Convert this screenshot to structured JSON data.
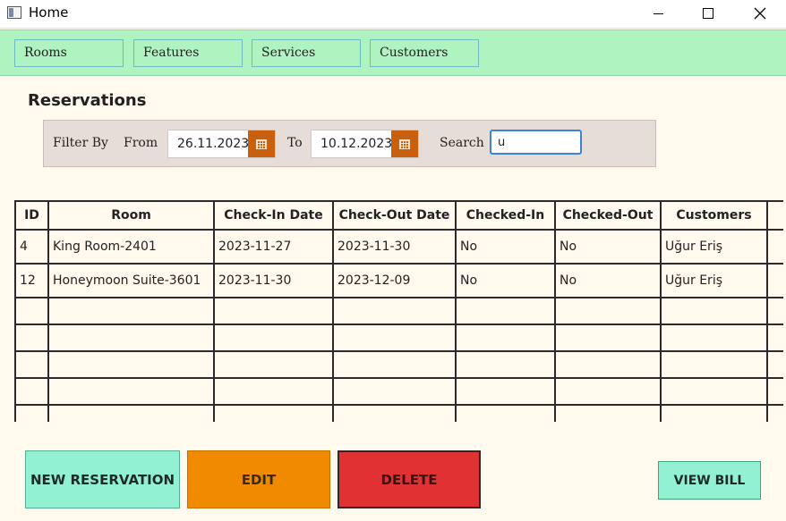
{
  "window": {
    "title": "Home",
    "minimize_label": "—",
    "maximize_label": "□",
    "close_label": "✕"
  },
  "nav": {
    "items": [
      {
        "label": "Rooms"
      },
      {
        "label": "Features"
      },
      {
        "label": "Services"
      },
      {
        "label": "Customers"
      }
    ]
  },
  "page": {
    "title": "Reservations"
  },
  "filter": {
    "filter_by_label": "Filter By",
    "from_label": "From",
    "from_value": "26.11.2023",
    "to_label": "To",
    "to_value": "10.12.2023",
    "search_label": "Search",
    "search_value": "u"
  },
  "table": {
    "columns": [
      "ID",
      "Room",
      "Check-In Date",
      "Check-Out Date",
      "Checked-In",
      "Checked-Out",
      "Customers"
    ],
    "rows": [
      [
        "4",
        "King Room-2401",
        "2023-11-27",
        "2023-11-30",
        "No",
        "No",
        "Uğur Eriş"
      ],
      [
        "12",
        "Honeymoon Suite-3601",
        "2023-11-30",
        "2023-12-09",
        "No",
        "No",
        "Uğur Eriş"
      ]
    ]
  },
  "buttons": {
    "new_reservation": "NEW RESERVATION",
    "edit": "EDIT",
    "delete": "DELETE",
    "view_bill": "VIEW BILL"
  },
  "colors": {
    "nav_bg": "#aef3c0",
    "calendar_button": "#c8600e",
    "new_button": "#92f0d3",
    "edit_button": "#f08a00",
    "delete_button": "#e03232",
    "search_focus": "#3e83d6"
  },
  "icons": {
    "app": "window-icon",
    "calendar": "calendar-icon"
  }
}
